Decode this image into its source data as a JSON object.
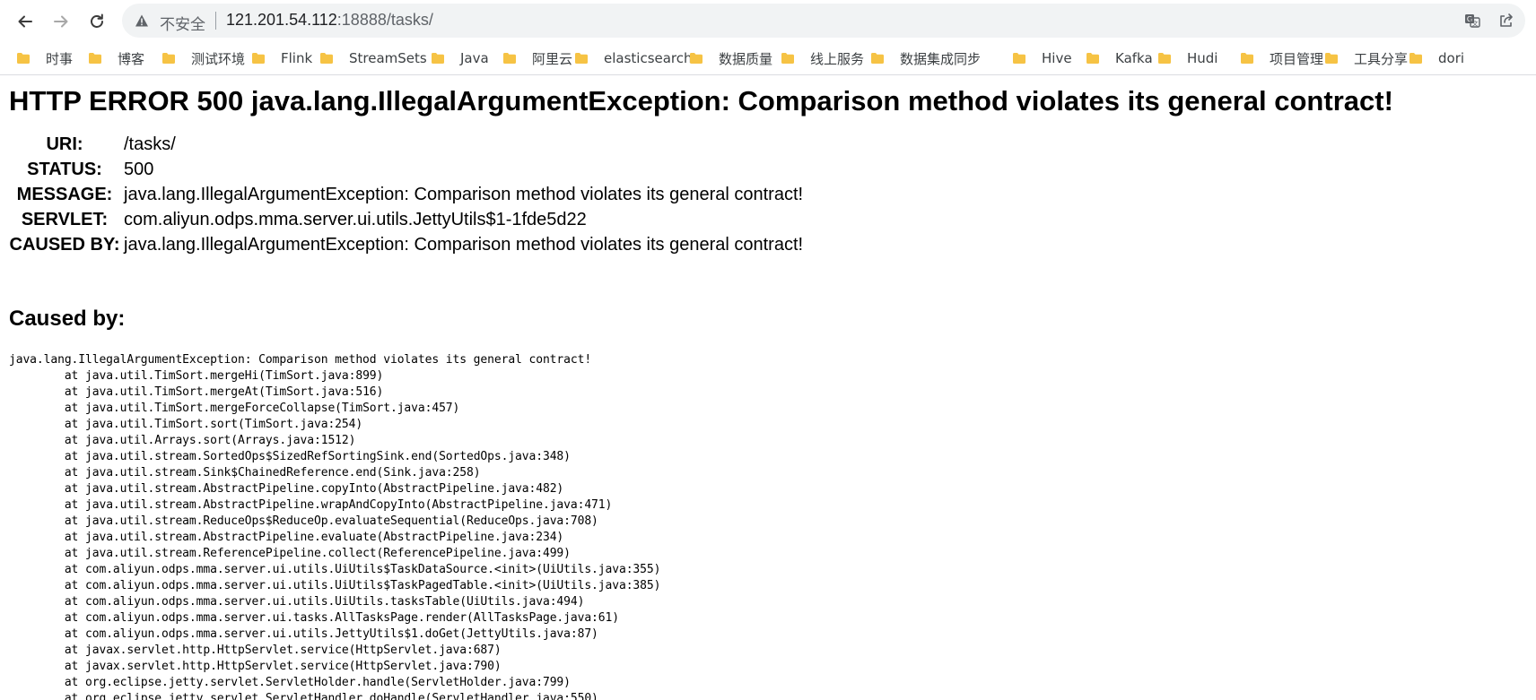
{
  "browser": {
    "security_label": "不安全",
    "url_host": "121.201.54.112",
    "url_rest": ":18888/tasks/"
  },
  "bookmarks": [
    {
      "label": "时事"
    },
    {
      "label": "博客"
    },
    {
      "label": "测试环境"
    },
    {
      "label": "Flink"
    },
    {
      "label": "StreamSets"
    },
    {
      "label": "Java"
    },
    {
      "label": "阿里云"
    },
    {
      "label": "elasticsearch"
    },
    {
      "label": "数据质量"
    },
    {
      "label": "线上服务"
    },
    {
      "label": "数据集成同步"
    },
    {
      "label": "Hive"
    },
    {
      "label": "Kafka"
    },
    {
      "label": "Hudi"
    },
    {
      "label": "项目管理"
    },
    {
      "label": "工具分享"
    },
    {
      "label": "dori"
    }
  ],
  "page": {
    "title": "HTTP ERROR 500 java.lang.IllegalArgumentException: Comparison method violates its general contract!",
    "info": [
      {
        "label": "URI:",
        "value": "/tasks/"
      },
      {
        "label": "STATUS:",
        "value": "500"
      },
      {
        "label": "MESSAGE:",
        "value": "java.lang.IllegalArgumentException: Comparison method violates its general contract!"
      },
      {
        "label": "SERVLET:",
        "value": "com.aliyun.odps.mma.server.ui.utils.JettyUtils$1-1fde5d22"
      },
      {
        "label": "CAUSED BY:",
        "value": "java.lang.IllegalArgumentException: Comparison method violates its general contract!"
      }
    ],
    "caused_by_heading": "Caused by:",
    "stack_trace": "java.lang.IllegalArgumentException: Comparison method violates its general contract!\n\tat java.util.TimSort.mergeHi(TimSort.java:899)\n\tat java.util.TimSort.mergeAt(TimSort.java:516)\n\tat java.util.TimSort.mergeForceCollapse(TimSort.java:457)\n\tat java.util.TimSort.sort(TimSort.java:254)\n\tat java.util.Arrays.sort(Arrays.java:1512)\n\tat java.util.stream.SortedOps$SizedRefSortingSink.end(SortedOps.java:348)\n\tat java.util.stream.Sink$ChainedReference.end(Sink.java:258)\n\tat java.util.stream.AbstractPipeline.copyInto(AbstractPipeline.java:482)\n\tat java.util.stream.AbstractPipeline.wrapAndCopyInto(AbstractPipeline.java:471)\n\tat java.util.stream.ReduceOps$ReduceOp.evaluateSequential(ReduceOps.java:708)\n\tat java.util.stream.AbstractPipeline.evaluate(AbstractPipeline.java:234)\n\tat java.util.stream.ReferencePipeline.collect(ReferencePipeline.java:499)\n\tat com.aliyun.odps.mma.server.ui.utils.UiUtils$TaskDataSource.<init>(UiUtils.java:355)\n\tat com.aliyun.odps.mma.server.ui.utils.UiUtils$TaskPagedTable.<init>(UiUtils.java:385)\n\tat com.aliyun.odps.mma.server.ui.utils.UiUtils.tasksTable(UiUtils.java:494)\n\tat com.aliyun.odps.mma.server.ui.tasks.AllTasksPage.render(AllTasksPage.java:61)\n\tat com.aliyun.odps.mma.server.ui.utils.JettyUtils$1.doGet(JettyUtils.java:87)\n\tat javax.servlet.http.HttpServlet.service(HttpServlet.java:687)\n\tat javax.servlet.http.HttpServlet.service(HttpServlet.java:790)\n\tat org.eclipse.jetty.servlet.ServletHolder.handle(ServletHolder.java:799)\n\tat org.eclipse.jetty.servlet.ServletHandler.doHandle(ServletHandler.java:550)"
  },
  "colors": {
    "folder": "#f6c344",
    "omnibox_bg": "#f1f3f4",
    "url_host": "#202124",
    "url_rest": "#5f6368"
  },
  "icons": {
    "back": "arrow-left-icon",
    "forward": "arrow-right-icon",
    "reload": "reload-icon",
    "security": "warning-triangle-icon",
    "translate": "translate-icon",
    "share": "share-icon",
    "bookmark_folder": "folder-icon"
  }
}
